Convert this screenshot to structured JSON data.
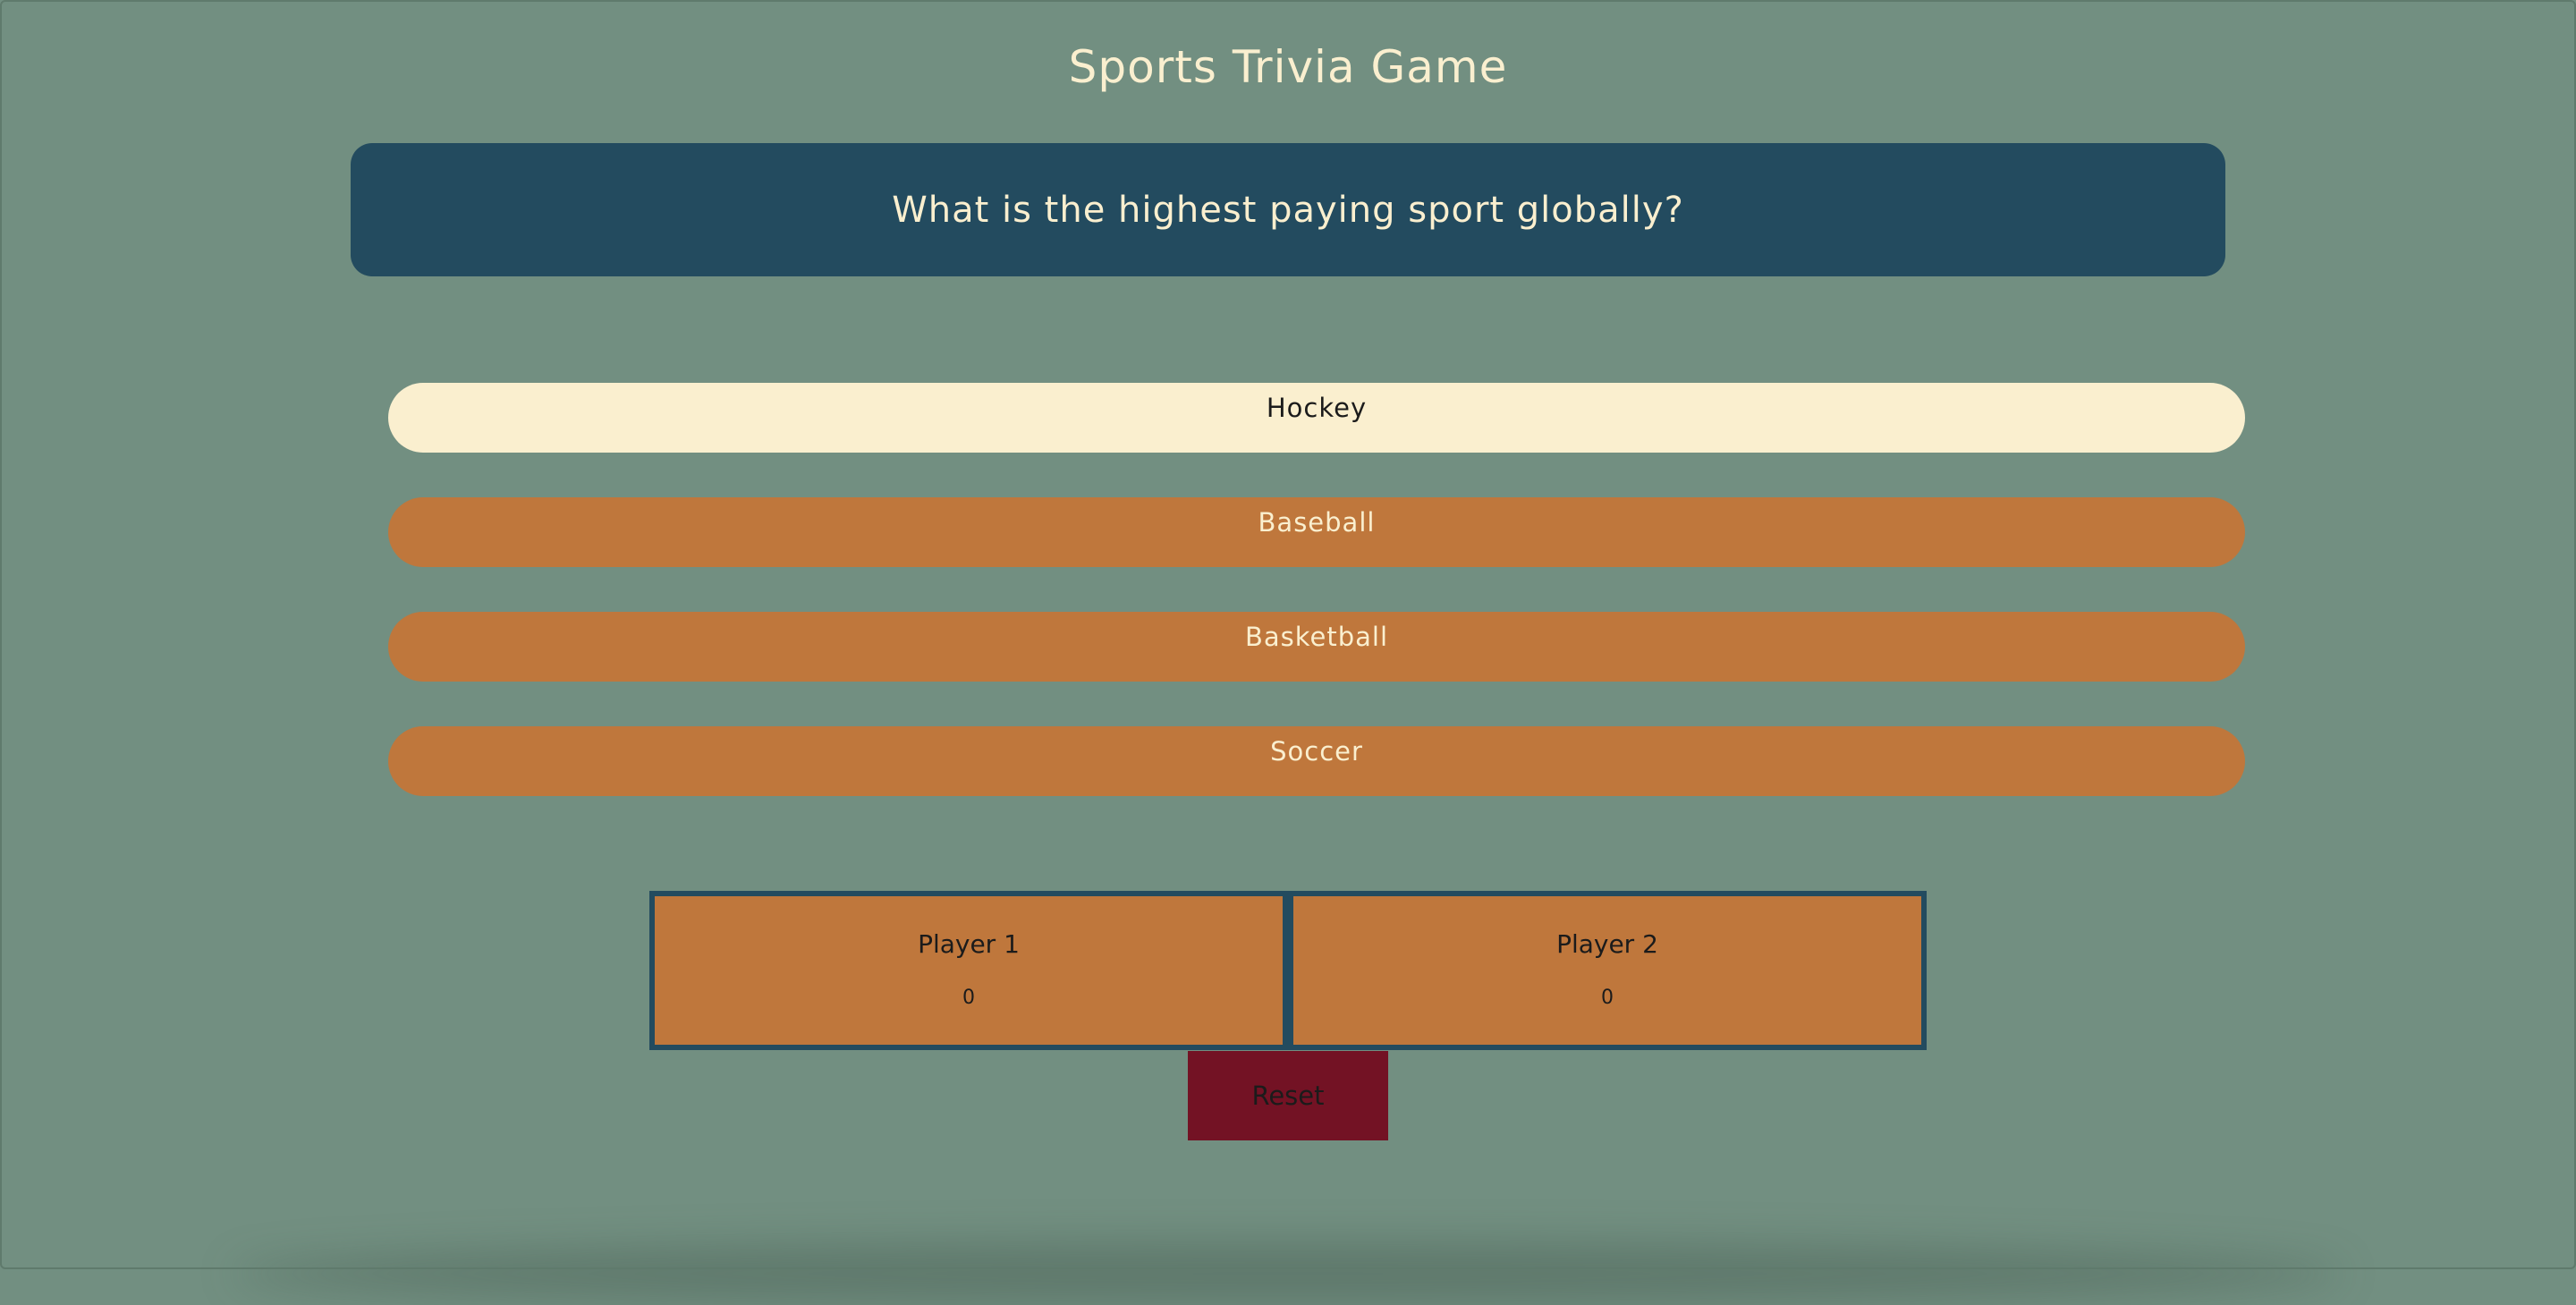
{
  "title": "Sports Trivia Game",
  "question": {
    "text": "What is the highest paying sport globally?"
  },
  "answers": [
    {
      "label": "Hockey",
      "state": "selected"
    },
    {
      "label": "Baseball",
      "state": "normal"
    },
    {
      "label": "Basketball",
      "state": "normal"
    },
    {
      "label": "Soccer",
      "state": "normal"
    }
  ],
  "players": [
    {
      "name": "Player 1",
      "score": "0"
    },
    {
      "name": "Player 2",
      "score": "0"
    }
  ],
  "reset_label": "Reset",
  "colors": {
    "background": "#728f81",
    "title_text": "#faefcf",
    "question_card": "#234b5f",
    "answer_selected": "#faefcf",
    "answer_normal": "#bf773c",
    "score_box": "#bf773c",
    "score_border": "#234b5f",
    "reset": "#731224"
  }
}
